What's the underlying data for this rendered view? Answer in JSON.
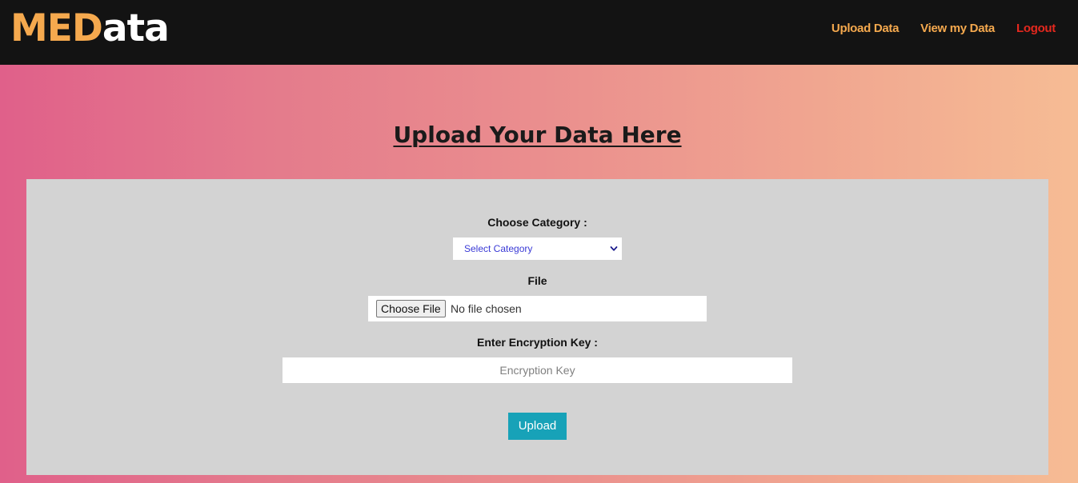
{
  "brand": {
    "accent_text": "MED",
    "rest_text": "ata",
    "accent_color": "#f5a94e"
  },
  "nav": {
    "items": [
      {
        "label": "Upload Data",
        "color": "#f5a94e"
      },
      {
        "label": "View my Data",
        "color": "#f5a94e"
      },
      {
        "label": "Logout",
        "color": "#e5281e"
      }
    ]
  },
  "page": {
    "title": "Upload Your Data Here"
  },
  "form": {
    "category_label": "Choose Category :",
    "category_selected": "Select Category",
    "category_icon": "chevron-down-icon",
    "file_label": "File",
    "file_button_label": "Choose File",
    "file_status": "No file chosen",
    "key_label": "Enter Encryption Key :",
    "key_placeholder": "Encryption Key",
    "key_value": "",
    "submit_label": "Upload",
    "submit_color": "#17a2b8"
  }
}
